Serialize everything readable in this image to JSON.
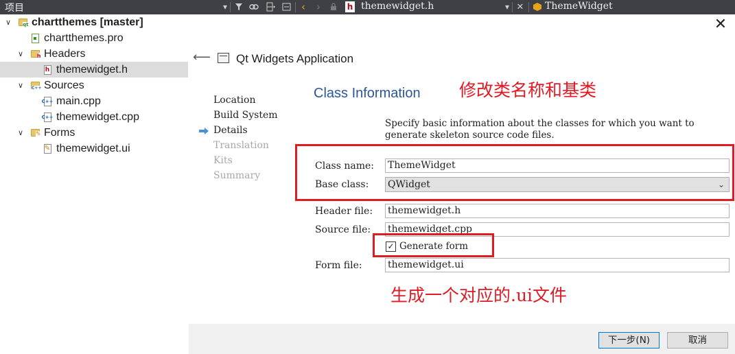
{
  "topbar": {
    "project_title": "项目",
    "file_tab": "themewidget.h",
    "class_name": "ThemeWidget"
  },
  "tree": {
    "items": [
      {
        "label": "chartthemes [master]",
        "icon": "qt-project-icon"
      },
      {
        "label": "chartthemes.pro",
        "icon": "pro-file-icon"
      },
      {
        "label": "Headers",
        "icon": "headers-folder-icon"
      },
      {
        "label": "themewidget.h",
        "icon": "header-file-icon"
      },
      {
        "label": "Sources",
        "icon": "sources-folder-icon"
      },
      {
        "label": "main.cpp",
        "icon": "cpp-file-icon"
      },
      {
        "label": "themewidget.cpp",
        "icon": "cpp-file-icon"
      },
      {
        "label": "Forms",
        "icon": "forms-folder-icon"
      },
      {
        "label": "themewidget.ui",
        "icon": "ui-file-icon"
      }
    ]
  },
  "wizard": {
    "title": "Qt Widgets Application",
    "section_title": "Class Information",
    "description": "Specify basic information about the classes for which you want to generate skeleton source code files.",
    "steps": [
      {
        "label": "Location",
        "state": "done"
      },
      {
        "label": "Build System",
        "state": "done"
      },
      {
        "label": "Details",
        "state": "current"
      },
      {
        "label": "Translation",
        "state": "pending"
      },
      {
        "label": "Kits",
        "state": "pending"
      },
      {
        "label": "Summary",
        "state": "pending"
      }
    ],
    "fields": {
      "class_name": {
        "label": "Class name:",
        "value": "ThemeWidget"
      },
      "base_class": {
        "label": "Base class:",
        "value": "QWidget"
      },
      "header_file": {
        "label": "Header file:",
        "value": "themewidget.h"
      },
      "source_file": {
        "label": "Source file:",
        "value": "themewidget.cpp"
      },
      "generate_form": {
        "label": "Generate form",
        "checked": true
      },
      "form_file": {
        "label": "Form file:",
        "value": "themewidget.ui"
      }
    },
    "annotations": {
      "top": "修改类名称和基类",
      "bottom": "生成一个对应的.ui文件"
    },
    "buttons": {
      "next": "下一步(N)",
      "cancel": "取消"
    }
  },
  "colors": {
    "annotation": "#e01b24",
    "section_title": "#2b579a",
    "topbar": "#3f3f46"
  }
}
